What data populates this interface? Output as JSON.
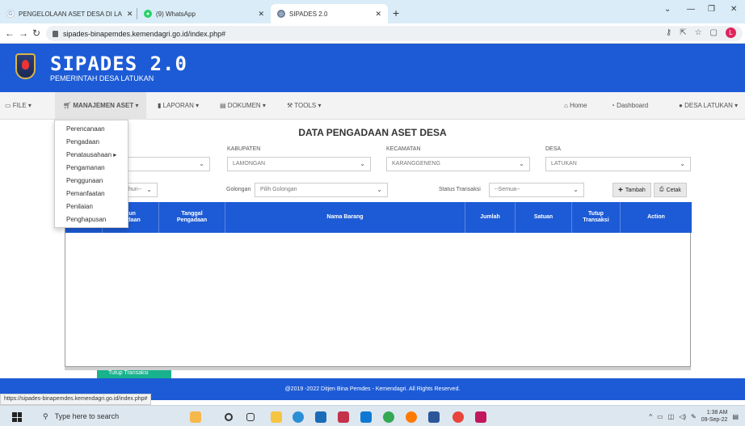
{
  "browser": {
    "tabs": [
      {
        "title": "PENGELOLAAN ASET DESA DI LA",
        "active": false
      },
      {
        "title": "(9) WhatsApp",
        "active": false
      },
      {
        "title": "SIPADES 2.0",
        "active": true
      }
    ],
    "url": "sipades-binapemdes.kemendagri.go.id/index.php#",
    "profile_initial": "L",
    "status_url": "https://sipades-binapemdes.kemendagri.go.id/index.php#"
  },
  "header": {
    "title": "SIPADES 2.0",
    "subtitle": "PEMERINTAH DESA LATUKAN"
  },
  "menu": {
    "file": "FILE",
    "manajemen_aset": "MANAJEMEN ASET",
    "laporan": "LAPORAN",
    "dokumen": "DOKUMEN",
    "tools": "TOOLS",
    "home": "Home",
    "dashboard": "Dashboard",
    "user": "DESA LATUKAN"
  },
  "dropdown": {
    "items": [
      "Perencanaan",
      "Pengadaan",
      "Penatausahaan",
      "Pengamanan",
      "Penggunaan",
      "Pemanfaatan",
      "Penilaian",
      "Penghapusan"
    ]
  },
  "page": {
    "title": "DATA PENGADAAN ASET DESA",
    "kabupaten_label": "KABUPATEN",
    "kabupaten_value": "LAMONGAN",
    "kecamatan_label": "KECAMATAN",
    "kecamatan_value": "KARANGGENENG",
    "desa_label": "DESA",
    "desa_value": "LATUKAN",
    "tahun_value": "hun--",
    "golongan_label": "Golongan",
    "golongan_placeholder": "Pilih Golongan",
    "status_label": "Status Transaksi",
    "status_value": "--Semua--",
    "tambah_label": "Tambah",
    "cetak_label": "Cetak",
    "tutup_label": "Tutup Transaksi"
  },
  "table": {
    "columns": [
      "hun\ngadaan",
      "Tanggal\nPengadaan",
      "Nama Barang",
      "Jumlah",
      "Satuan",
      "Tutup\nTransaksi",
      "Action"
    ]
  },
  "footer": {
    "text": "@2019 -2022 Ditjen Bina Pemdes - Kemendagri. All Rights Reserved."
  },
  "taskbar": {
    "search_placeholder": "Type here to search",
    "time": "1:38 AM",
    "date": "09-Sep-22"
  },
  "colors": {
    "primary": "#1d5bd6",
    "tutup_button": "#18b28d"
  }
}
